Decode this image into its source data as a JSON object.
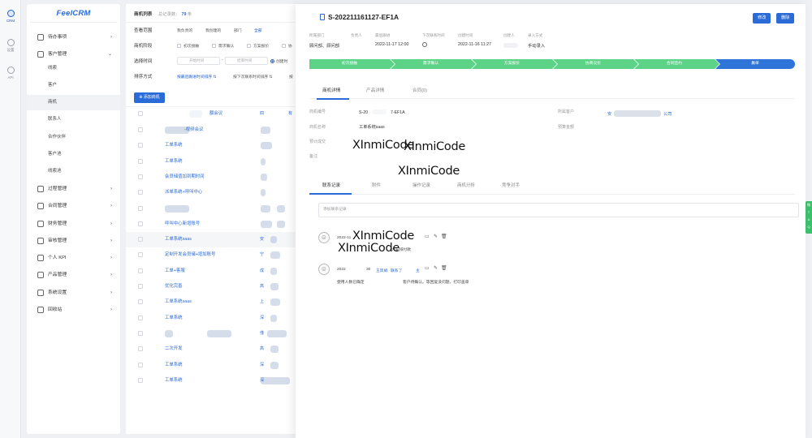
{
  "rail": {
    "items": [
      {
        "label": "CRM"
      },
      {
        "label": "设置"
      },
      {
        "label": "API"
      }
    ]
  },
  "sidebar": {
    "logo": "FeelCRM",
    "items": [
      {
        "label": "待办事项"
      },
      {
        "label": "客户管理"
      },
      {
        "label": "线索"
      },
      {
        "label": "客户"
      },
      {
        "label": "商机"
      },
      {
        "label": "联系人"
      },
      {
        "label": "合作伙伴"
      },
      {
        "label": "客户池"
      },
      {
        "label": "线索池"
      },
      {
        "label": "过程管理"
      },
      {
        "label": "合同管理"
      },
      {
        "label": "财务管理"
      },
      {
        "label": "审核管理"
      },
      {
        "label": "个人 KPI"
      },
      {
        "label": "产品管理"
      },
      {
        "label": "系统设置"
      },
      {
        "label": "回收站"
      }
    ]
  },
  "list": {
    "title": "商机列表",
    "count_label": "总记录数：",
    "count": "79",
    "count_unit": "条",
    "filters": {
      "scope_label": "查看范围",
      "scope_opts": [
        "我负责的",
        "我创建的",
        "部门",
        "全部"
      ],
      "stage_label": "商机阶段",
      "stage_opts": [
        "初次接触",
        "需求确认",
        "方案报价",
        "协"
      ],
      "time_label": "选择时间",
      "time_start": "开始时间",
      "time_sep": "-",
      "time_end": "结束时间",
      "time_type": "创建时",
      "sort_label": "排序方式",
      "sort_opts": [
        "按最后跟进时间排序",
        "按下次联系时间排序",
        "按"
      ]
    },
    "add_button": "添加商机",
    "header_cols": [
      "额会议",
      "四",
      "有"
    ],
    "rows": [
      {
        "name": "-视频会议",
        "extra": ""
      },
      {
        "name": "工单系统",
        "extra": ""
      },
      {
        "name": "工单系统",
        "extra": ""
      },
      {
        "name": "会员储值加到期时间",
        "extra": ""
      },
      {
        "name": "派单系统+呼叫中心",
        "extra": ""
      },
      {
        "name": "",
        "extra": ""
      },
      {
        "name": "呼叫中心新增账号",
        "extra": ""
      },
      {
        "name": "工单系统saas",
        "extra": "安"
      },
      {
        "name": "定制开发会员储+增加账号",
        "extra": "宁"
      },
      {
        "name": "工单+客服",
        "extra": "成"
      },
      {
        "name": "优化完善",
        "extra": "高"
      },
      {
        "name": "工单系统saas",
        "extra": "上"
      },
      {
        "name": "工单系统",
        "extra": "深"
      },
      {
        "name": "",
        "extra": "僅"
      },
      {
        "name": "二次开发",
        "extra": "高"
      },
      {
        "name": "工单系统",
        "extra": "深"
      },
      {
        "name": "工单系统",
        "extra": "深"
      }
    ]
  },
  "detail": {
    "title": "S-202211161127-EF1A",
    "edit_button": "修改",
    "delete_button": "删除",
    "meta": [
      {
        "k": "所属部门",
        "v": "顾问部、顾问部"
      },
      {
        "k": "负责人",
        "v": ""
      },
      {
        "k": "最后跟进",
        "v": "2022-11-17 12:00"
      },
      {
        "k": "下次联系时间",
        "v": ""
      },
      {
        "k": "创建时间",
        "v": "2022-11-16 11:27"
      },
      {
        "k": "创建人",
        "v": ""
      },
      {
        "k": "录入方式",
        "v": "手动录入"
      }
    ],
    "stages": [
      {
        "label": "初次接触",
        "done": true
      },
      {
        "label": "需求确认",
        "done": true
      },
      {
        "label": "方案报价",
        "done": true
      },
      {
        "label": "协商议价",
        "done": true
      },
      {
        "label": "合同签约",
        "done": true
      },
      {
        "label": "赢单",
        "done": false
      }
    ],
    "tabs": [
      "商机详情",
      "产品详情",
      "合同(0)"
    ],
    "fields": {
      "code_label": "商机编号",
      "code_a": "S-20",
      "code_b": "7-EF1A",
      "customer_label": "所属客户",
      "customer_prefix": "安",
      "customer_suffix": "公司",
      "name_label": "商机名称",
      "name_value": "工单系统saas",
      "budget_label": "预算金额",
      "deal_label": "预计成交",
      "note_label": "备注"
    },
    "watermark": "XInmiCode",
    "tabs2": [
      "联系记录",
      "附件",
      "操作记录",
      "商机分析",
      "竞争对手"
    ],
    "comment_placeholder": "添加联系记录",
    "records": [
      {
        "date": "2022-11",
        "body": "大安排付款"
      },
      {
        "date": "2022",
        "mid": "30",
        "user": "王凤娟",
        "action": "联系了",
        "tag": "主",
        "body": "使用人数已确定",
        "body2": "客户待确认。等回复没问题，打印盖章"
      }
    ],
    "float_tools": [
      "微",
      "T",
      "A",
      "Q"
    ]
  },
  "colors": {
    "primary": "#2a6bd8",
    "stage_done": "#5dd388",
    "stage_current": "#2f74d8"
  }
}
